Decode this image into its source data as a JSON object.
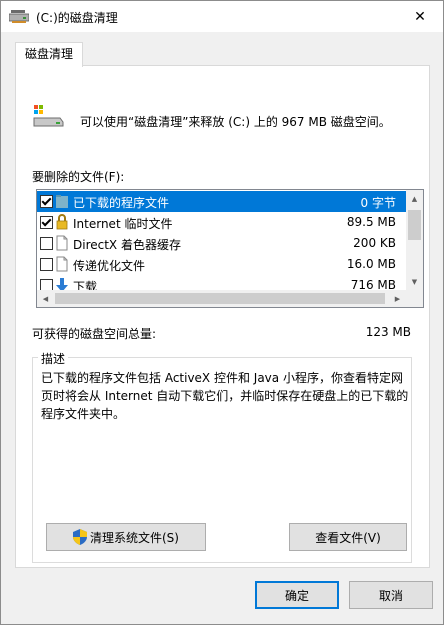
{
  "window": {
    "title": "(C:)的磁盘清理",
    "close_glyph": "✕"
  },
  "tab": {
    "label": "磁盘清理"
  },
  "summary": "可以使用“磁盘清理”来释放  (C:) 上的 967 MB 磁盘空间。",
  "files_label": "要删除的文件(F):",
  "files": [
    {
      "name": "已下载的程序文件",
      "size": "0 字节",
      "checked": true,
      "icon": "folder-icon",
      "selected": true
    },
    {
      "name": "Internet 临时文件",
      "size": "89.5 MB",
      "checked": true,
      "icon": "lock-icon",
      "selected": false
    },
    {
      "name": "DirectX 着色器缓存",
      "size": "200 KB",
      "checked": false,
      "icon": "document-icon",
      "selected": false
    },
    {
      "name": "传递优化文件",
      "size": "16.0 MB",
      "checked": false,
      "icon": "document-icon",
      "selected": false
    },
    {
      "name": "下载",
      "size": "716 MB",
      "checked": false,
      "icon": "download-arrow-icon",
      "selected": false
    }
  ],
  "total": {
    "label": "可获得的磁盘空间总量:",
    "value": "123 MB"
  },
  "description": {
    "legend": "描述",
    "text": "已下载的程序文件包括 ActiveX 控件和 Java 小程序，你查看特定网页时将会从 Internet 自动下载它们，并临时保存在硬盘上的已下载的程序文件夹中。"
  },
  "buttons": {
    "cleanup_system": "清理系统文件(S)",
    "view_files": "查看文件(V)",
    "ok": "确定",
    "cancel": "取消"
  },
  "colors": {
    "selection": "#0078d7",
    "panel_bg": "#ffffff",
    "dialog_bg": "#f0f0f0"
  }
}
